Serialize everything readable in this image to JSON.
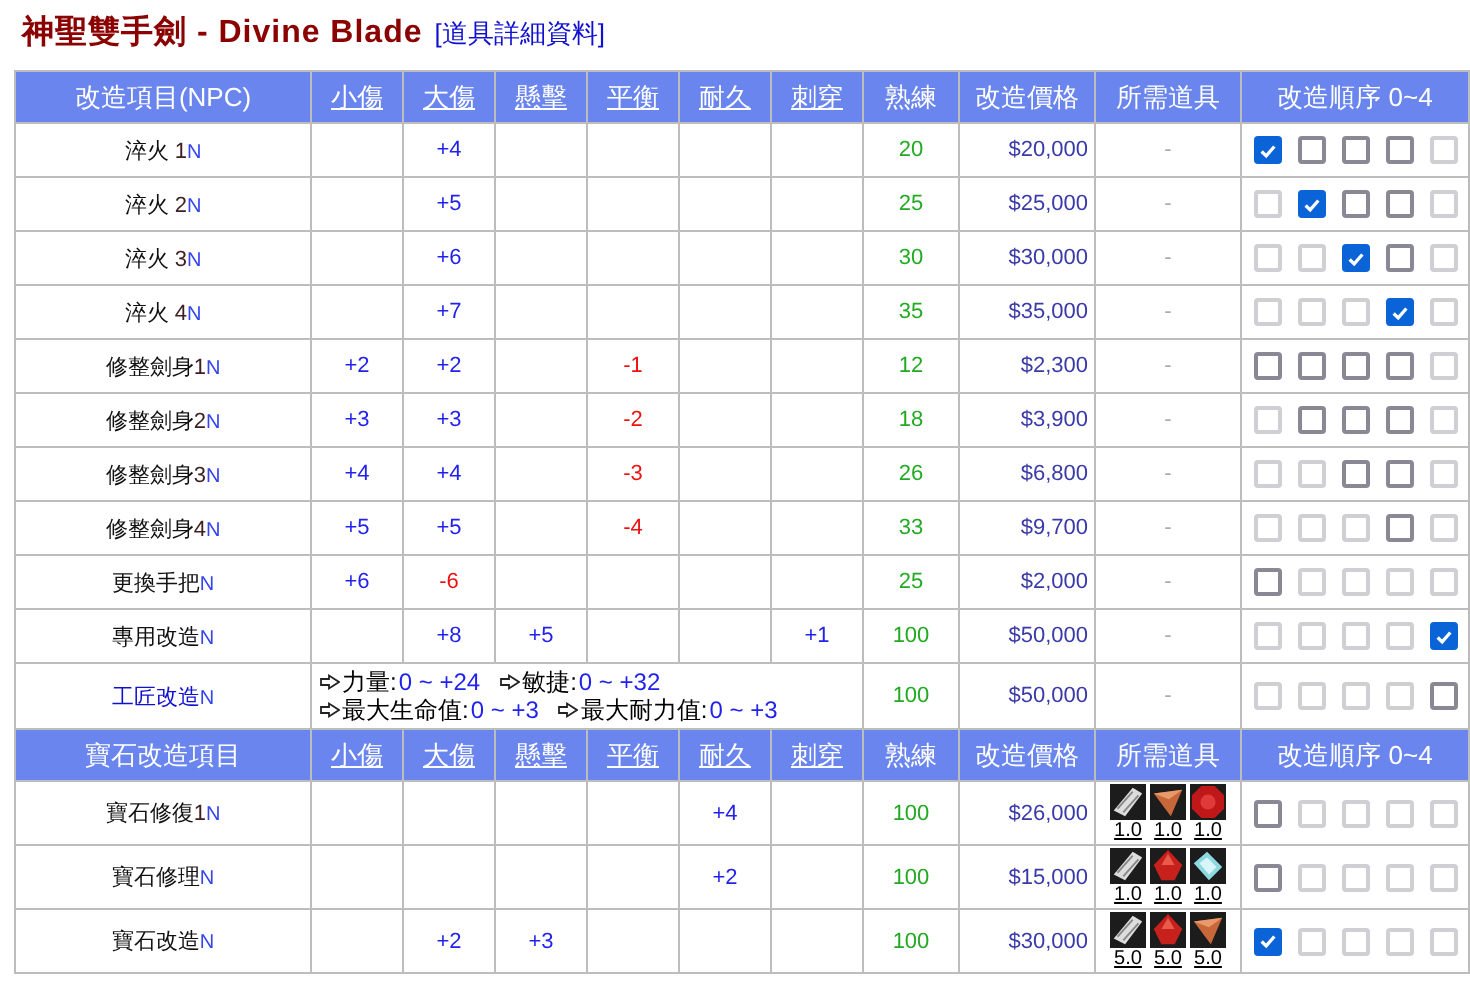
{
  "title": {
    "name": "神聖雙手劍 - Divine Blade",
    "link": "[道具詳細資料]"
  },
  "sections": [
    {
      "header": [
        {
          "label": "改造項目(NPC)",
          "link": false
        },
        {
          "label": "小傷",
          "link": true
        },
        {
          "label": "大傷",
          "link": true
        },
        {
          "label": "懸擊",
          "link": true
        },
        {
          "label": "平衡",
          "link": true
        },
        {
          "label": "耐久",
          "link": true
        },
        {
          "label": "刺穿",
          "link": true
        },
        {
          "label": "熟練",
          "link": false
        },
        {
          "label": "改造價格",
          "link": false
        },
        {
          "label": "所需道具",
          "link": false
        },
        {
          "label": "改造順序 0~4",
          "link": false
        }
      ],
      "rows": [
        {
          "name": "淬火 ",
          "level": "1",
          "tag": "N",
          "link": false,
          "stats": {
            "max_damage": {
              "text": "+4",
              "negative": false
            }
          },
          "proficiency": "20",
          "price": "$20,000",
          "items_text": "-",
          "order": [
            {
              "checked": true
            },
            {
              "checked": false,
              "disabled": false
            },
            {
              "checked": false,
              "disabled": false
            },
            {
              "checked": false,
              "disabled": false
            },
            {
              "checked": false,
              "disabled": true
            }
          ]
        },
        {
          "name": "淬火 ",
          "level": "2",
          "tag": "N",
          "link": false,
          "stats": {
            "max_damage": {
              "text": "+5",
              "negative": false
            }
          },
          "proficiency": "25",
          "price": "$25,000",
          "items_text": "-",
          "order": [
            {
              "checked": false,
              "disabled": true
            },
            {
              "checked": true
            },
            {
              "checked": false,
              "disabled": false
            },
            {
              "checked": false,
              "disabled": false
            },
            {
              "checked": false,
              "disabled": true
            }
          ]
        },
        {
          "name": "淬火 ",
          "level": "3",
          "tag": "N",
          "link": false,
          "stats": {
            "max_damage": {
              "text": "+6",
              "negative": false
            }
          },
          "proficiency": "30",
          "price": "$30,000",
          "items_text": "-",
          "order": [
            {
              "checked": false,
              "disabled": true
            },
            {
              "checked": false,
              "disabled": true
            },
            {
              "checked": true
            },
            {
              "checked": false,
              "disabled": false
            },
            {
              "checked": false,
              "disabled": true
            }
          ]
        },
        {
          "name": "淬火 ",
          "level": "4",
          "tag": "N",
          "link": false,
          "stats": {
            "max_damage": {
              "text": "+7",
              "negative": false
            }
          },
          "proficiency": "35",
          "price": "$35,000",
          "items_text": "-",
          "order": [
            {
              "checked": false,
              "disabled": true
            },
            {
              "checked": false,
              "disabled": true
            },
            {
              "checked": false,
              "disabled": true
            },
            {
              "checked": true
            },
            {
              "checked": false,
              "disabled": true
            }
          ]
        },
        {
          "name": "修整劍身",
          "level": "1",
          "tag": "N",
          "link": false,
          "stats": {
            "min_damage": {
              "text": "+2",
              "negative": false
            },
            "max_damage": {
              "text": "+2",
              "negative": false
            },
            "balance": {
              "text": "-1",
              "negative": true
            }
          },
          "proficiency": "12",
          "price": "$2,300",
          "items_text": "-",
          "order": [
            {
              "checked": false,
              "disabled": false
            },
            {
              "checked": false,
              "disabled": false
            },
            {
              "checked": false,
              "disabled": false
            },
            {
              "checked": false,
              "disabled": false
            },
            {
              "checked": false,
              "disabled": true
            }
          ]
        },
        {
          "name": "修整劍身",
          "level": "2",
          "tag": "N",
          "link": false,
          "stats": {
            "min_damage": {
              "text": "+3",
              "negative": false
            },
            "max_damage": {
              "text": "+3",
              "negative": false
            },
            "balance": {
              "text": "-2",
              "negative": true
            }
          },
          "proficiency": "18",
          "price": "$3,900",
          "items_text": "-",
          "order": [
            {
              "checked": false,
              "disabled": true
            },
            {
              "checked": false,
              "disabled": false
            },
            {
              "checked": false,
              "disabled": false
            },
            {
              "checked": false,
              "disabled": false
            },
            {
              "checked": false,
              "disabled": true
            }
          ]
        },
        {
          "name": "修整劍身",
          "level": "3",
          "tag": "N",
          "link": false,
          "stats": {
            "min_damage": {
              "text": "+4",
              "negative": false
            },
            "max_damage": {
              "text": "+4",
              "negative": false
            },
            "balance": {
              "text": "-3",
              "negative": true
            }
          },
          "proficiency": "26",
          "price": "$6,800",
          "items_text": "-",
          "order": [
            {
              "checked": false,
              "disabled": true
            },
            {
              "checked": false,
              "disabled": true
            },
            {
              "checked": false,
              "disabled": false
            },
            {
              "checked": false,
              "disabled": false
            },
            {
              "checked": false,
              "disabled": true
            }
          ]
        },
        {
          "name": "修整劍身",
          "level": "4",
          "tag": "N",
          "link": false,
          "stats": {
            "min_damage": {
              "text": "+5",
              "negative": false
            },
            "max_damage": {
              "text": "+5",
              "negative": false
            },
            "balance": {
              "text": "-4",
              "negative": true
            }
          },
          "proficiency": "33",
          "price": "$9,700",
          "items_text": "-",
          "order": [
            {
              "checked": false,
              "disabled": true
            },
            {
              "checked": false,
              "disabled": true
            },
            {
              "checked": false,
              "disabled": true
            },
            {
              "checked": false,
              "disabled": false
            },
            {
              "checked": false,
              "disabled": true
            }
          ]
        },
        {
          "name": "更換手把",
          "tag": "N",
          "link": false,
          "stats": {
            "min_damage": {
              "text": "+6",
              "negative": false
            },
            "max_damage": {
              "text": "-6",
              "negative": true
            }
          },
          "proficiency": "25",
          "price": "$2,000",
          "items_text": "-",
          "order": [
            {
              "checked": false,
              "disabled": false
            },
            {
              "checked": false,
              "disabled": true
            },
            {
              "checked": false,
              "disabled": true
            },
            {
              "checked": false,
              "disabled": true
            },
            {
              "checked": false,
              "disabled": true
            }
          ]
        },
        {
          "name": "專用改造",
          "tag": "N",
          "link": false,
          "stats": {
            "max_damage": {
              "text": "+8",
              "negative": false
            },
            "critical": {
              "text": "+5",
              "negative": false
            },
            "piercing": {
              "text": "+1",
              "negative": false
            }
          },
          "proficiency": "100",
          "price": "$50,000",
          "items_text": "-",
          "order": [
            {
              "checked": false,
              "disabled": true
            },
            {
              "checked": false,
              "disabled": true
            },
            {
              "checked": false,
              "disabled": true
            },
            {
              "checked": false,
              "disabled": true
            },
            {
              "checked": true
            }
          ]
        },
        {
          "name": "工匠改造",
          "tag": "N",
          "link": true,
          "bonus_lines": [
            [
              {
                "label": "力量:",
                "range": "0 ~ +24"
              },
              {
                "label": "敏捷:",
                "range": "0 ~ +32"
              }
            ],
            [
              {
                "label": "最大生命值:",
                "range": "0 ~ +3"
              },
              {
                "label": "最大耐力值:",
                "range": "0 ~ +3"
              }
            ]
          ],
          "proficiency": "100",
          "price": "$50,000",
          "items_text": "-",
          "order": [
            {
              "checked": false,
              "disabled": true
            },
            {
              "checked": false,
              "disabled": true
            },
            {
              "checked": false,
              "disabled": true
            },
            {
              "checked": false,
              "disabled": true
            },
            {
              "checked": false,
              "disabled": false
            }
          ]
        }
      ]
    },
    {
      "header": [
        {
          "label": "寶石改造項目",
          "link": false
        },
        {
          "label": "小傷",
          "link": true
        },
        {
          "label": "大傷",
          "link": true
        },
        {
          "label": "懸擊",
          "link": true
        },
        {
          "label": "平衡",
          "link": true
        },
        {
          "label": "耐久",
          "link": true
        },
        {
          "label": "刺穿",
          "link": true
        },
        {
          "label": "熟練",
          "link": false
        },
        {
          "label": "改造價格",
          "link": false
        },
        {
          "label": "所需道具",
          "link": false
        },
        {
          "label": "改造順序 0~4",
          "link": false
        }
      ],
      "rows": [
        {
          "name": "寶石修復",
          "level": "1",
          "tag": "N",
          "link": false,
          "stats": {
            "durability": {
              "text": "+4",
              "negative": false
            }
          },
          "proficiency": "100",
          "price": "$26,000",
          "items": [
            {
              "kind": "stone",
              "qty": "1.0"
            },
            {
              "kind": "cone",
              "qty": "1.0"
            },
            {
              "kind": "ruby",
              "qty": "1.0"
            }
          ],
          "order": [
            {
              "checked": false,
              "disabled": false
            },
            {
              "checked": false,
              "disabled": true
            },
            {
              "checked": false,
              "disabled": true
            },
            {
              "checked": false,
              "disabled": true
            },
            {
              "checked": false,
              "disabled": true
            }
          ]
        },
        {
          "name": "寶石修理",
          "tag": "N",
          "link": false,
          "stats": {
            "durability": {
              "text": "+2",
              "negative": false
            }
          },
          "proficiency": "100",
          "price": "$15,000",
          "items": [
            {
              "kind": "stone",
              "qty": "1.0"
            },
            {
              "kind": "drop",
              "qty": "1.0"
            },
            {
              "kind": "crystal",
              "qty": "1.0"
            }
          ],
          "order": [
            {
              "checked": false,
              "disabled": false
            },
            {
              "checked": false,
              "disabled": true
            },
            {
              "checked": false,
              "disabled": true
            },
            {
              "checked": false,
              "disabled": true
            },
            {
              "checked": false,
              "disabled": true
            }
          ]
        },
        {
          "name": "寶石改造",
          "tag": "N",
          "link": false,
          "stats": {
            "max_damage": {
              "text": "+2",
              "negative": false
            },
            "critical": {
              "text": "+3",
              "negative": false
            }
          },
          "proficiency": "100",
          "price": "$30,000",
          "items": [
            {
              "kind": "stone",
              "qty": "5.0"
            },
            {
              "kind": "drop",
              "qty": "5.0"
            },
            {
              "kind": "cone",
              "qty": "5.0"
            }
          ],
          "order": [
            {
              "checked": true
            },
            {
              "checked": false,
              "disabled": true
            },
            {
              "checked": false,
              "disabled": true
            },
            {
              "checked": false,
              "disabled": true
            },
            {
              "checked": false,
              "disabled": true
            }
          ]
        }
      ]
    }
  ]
}
